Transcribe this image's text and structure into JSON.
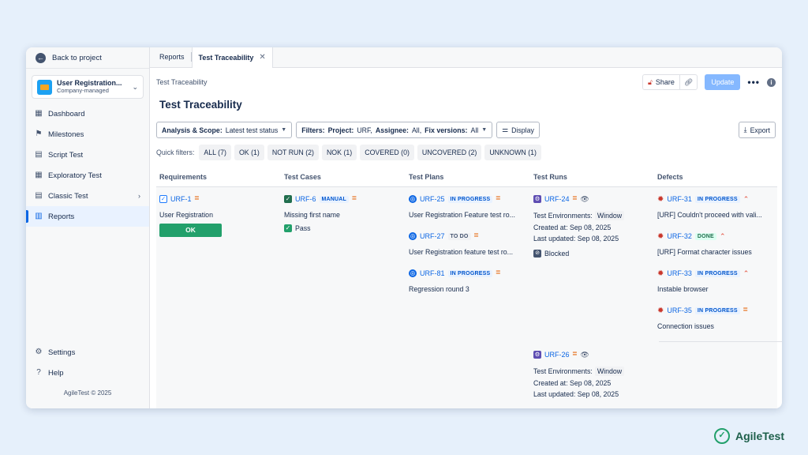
{
  "sidebar": {
    "back": "Back to project",
    "project": {
      "name": "User Registration...",
      "type": "Company-managed"
    },
    "items": [
      {
        "label": "Dashboard",
        "icon": "dashboard-icon"
      },
      {
        "label": "Milestones",
        "icon": "flag-icon"
      },
      {
        "label": "Script Test",
        "icon": "script-test-icon"
      },
      {
        "label": "Exploratory Test",
        "icon": "exploratory-test-icon"
      },
      {
        "label": "Classic Test",
        "icon": "classic-test-icon"
      },
      {
        "label": "Reports",
        "icon": "reports-icon"
      }
    ],
    "settings": "Settings",
    "help": "Help",
    "copyright": "AgileTest © 2025"
  },
  "tabs": [
    "Reports",
    "Test Traceability"
  ],
  "main": {
    "breadcrumb": "Test Traceability",
    "title": "Test Traceability",
    "share": "Share",
    "update": "Update",
    "filters": {
      "scope_label": "Analysis & Scope:",
      "scope_value": "Latest test status",
      "filters_label": "Filters:",
      "project_label": "Project:",
      "project_value": "URF,",
      "assignee_label": "Assignee:",
      "assignee_value": "All,",
      "fix_label": "Fix versions:",
      "fix_value": "All",
      "display": "Display",
      "export": "Export"
    },
    "quick_filters_label": "Quick filters:",
    "quick_filters": [
      "ALL (7)",
      "OK (1)",
      "NOT RUN (2)",
      "NOK (1)",
      "COVERED (0)",
      "UNCOVERED (2)",
      "UNKNOWN (1)"
    ],
    "columns": [
      "Requirements",
      "Test Cases",
      "Test Plans",
      "Test Runs",
      "Defects"
    ]
  },
  "grid": {
    "requirement": {
      "key": "URF-1",
      "summary": "User Registration",
      "status": "OK"
    },
    "test_case": {
      "key": "URF-6",
      "type": "MANUAL",
      "summary": "Missing first name",
      "result": "Pass"
    },
    "test_plans": [
      {
        "key": "URF-25",
        "status": "IN PROGRESS",
        "summary": "User Registration Feature test ro..."
      },
      {
        "key": "URF-27",
        "status": "TO DO",
        "summary": "User Registration feature test ro..."
      },
      {
        "key": "URF-81",
        "status": "IN PROGRESS",
        "summary": "Regression round 3"
      }
    ],
    "test_runs": [
      {
        "key": "URF-24",
        "env_label": "Test Environments:",
        "env_value": "Window",
        "created": "Created at: Sep 08, 2025",
        "updated": "Last updated: Sep 08, 2025",
        "status": "Blocked"
      },
      {
        "key": "URF-26",
        "env_label": "Test Environments:",
        "env_value": "Window",
        "created": "Created at: Sep 08, 2025",
        "updated": "Last updated: Sep 08, 2025"
      }
    ],
    "defects": [
      {
        "key": "URF-31",
        "status": "IN PROGRESS",
        "summary": "[URF] Couldn't proceed with vali..."
      },
      {
        "key": "URF-32",
        "status": "DONE",
        "summary": "[URF] Format character issues"
      },
      {
        "key": "URF-33",
        "status": "IN PROGRESS",
        "summary": "Instable browser"
      },
      {
        "key": "URF-35",
        "status": "IN PROGRESS",
        "summary": "Connection issues"
      }
    ]
  },
  "brand": "AgileTest"
}
